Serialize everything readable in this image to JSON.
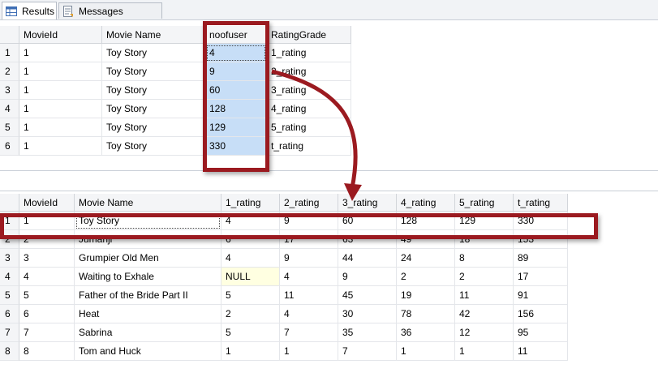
{
  "tabs": [
    {
      "label": "Results",
      "icon": "results-grid-icon",
      "active": true
    },
    {
      "label": "Messages",
      "icon": "messages-icon",
      "active": false
    }
  ],
  "top_grid": {
    "columns": [
      "MovieId",
      "Movie Name",
      "noofuser",
      "RatingGrade"
    ],
    "rows": [
      {
        "num": "1",
        "cells": [
          "1",
          "Toy Story",
          "4",
          "1_rating"
        ]
      },
      {
        "num": "2",
        "cells": [
          "1",
          "Toy Story",
          "9",
          "2_rating"
        ]
      },
      {
        "num": "3",
        "cells": [
          "1",
          "Toy Story",
          "60",
          "3_rating"
        ]
      },
      {
        "num": "4",
        "cells": [
          "1",
          "Toy Story",
          "128",
          "4_rating"
        ]
      },
      {
        "num": "5",
        "cells": [
          "1",
          "Toy Story",
          "129",
          "5_rating"
        ]
      },
      {
        "num": "6",
        "cells": [
          "1",
          "Toy Story",
          "330",
          "t_rating"
        ]
      }
    ]
  },
  "bottom_grid": {
    "columns": [
      "MovieId",
      "Movie Name",
      "1_rating",
      "2_rating",
      "3_rating",
      "4_rating",
      "5_rating",
      "t_rating"
    ],
    "rows": [
      {
        "num": "1",
        "cells": [
          "1",
          "Toy Story",
          "4",
          "9",
          "60",
          "128",
          "129",
          "330"
        ]
      },
      {
        "num": "2",
        "cells": [
          "2",
          "Jumanji",
          "6",
          "17",
          "63",
          "49",
          "18",
          "153"
        ]
      },
      {
        "num": "3",
        "cells": [
          "3",
          "Grumpier Old Men",
          "4",
          "9",
          "44",
          "24",
          "8",
          "89"
        ]
      },
      {
        "num": "4",
        "cells": [
          "4",
          "Waiting to Exhale",
          "NULL",
          "4",
          "9",
          "2",
          "2",
          "17"
        ]
      },
      {
        "num": "5",
        "cells": [
          "5",
          "Father of the Bride Part II",
          "5",
          "11",
          "45",
          "19",
          "11",
          "91"
        ]
      },
      {
        "num": "6",
        "cells": [
          "6",
          "Heat",
          "2",
          "4",
          "30",
          "78",
          "42",
          "156"
        ]
      },
      {
        "num": "7",
        "cells": [
          "7",
          "Sabrina",
          "5",
          "7",
          "35",
          "36",
          "12",
          "95"
        ]
      },
      {
        "num": "8",
        "cells": [
          "8",
          "Tom and Huck",
          "1",
          "1",
          "7",
          "1",
          "1",
          "11"
        ]
      }
    ]
  },
  "colors": {
    "highlight": "#9b1a20",
    "selection": "#c7def7",
    "null_cell": "#ffffe1"
  }
}
